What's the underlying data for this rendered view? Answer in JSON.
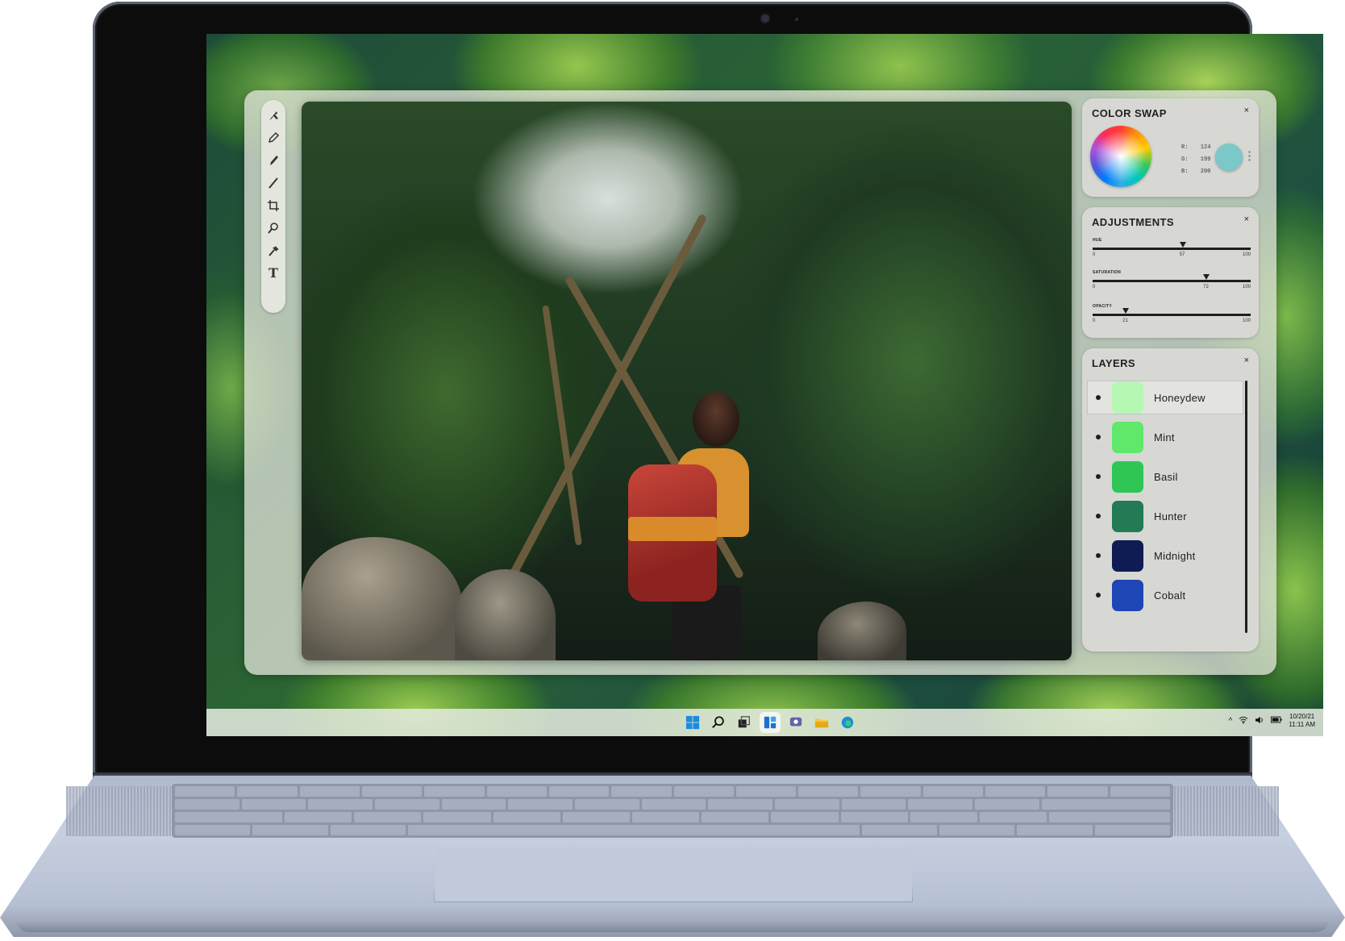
{
  "color_swap": {
    "title": "COLOR SWAP",
    "close": "×",
    "r_label": "R:",
    "r_value": "124",
    "g_label": "G:",
    "g_value": "199",
    "b_label": "B:",
    "b_value": "200",
    "preview_color": "#7cc7c8"
  },
  "adjustments": {
    "title": "ADJUSTMENTS",
    "close": "×",
    "sliders": [
      {
        "label": "HUE",
        "min": "0",
        "max": "100",
        "value": 57,
        "value_text": "57"
      },
      {
        "label": "SATURATION",
        "min": "0",
        "max": "100",
        "value": 72,
        "value_text": "72"
      },
      {
        "label": "OPACITY",
        "min": "0",
        "max": "100",
        "value": 21,
        "value_text": "21"
      }
    ]
  },
  "layers": {
    "title": "LAYERS",
    "close": "×",
    "items": [
      {
        "name": "Honeydew",
        "color": "#b4f8b4",
        "selected": true
      },
      {
        "name": "Mint",
        "color": "#5fe86a"
      },
      {
        "name": "Basil",
        "color": "#2fc656"
      },
      {
        "name": "Hunter",
        "color": "#237a54"
      },
      {
        "name": "Midnight",
        "color": "#0f1c54"
      },
      {
        "name": "Cobalt",
        "color": "#1e46b4"
      }
    ]
  },
  "toolbar": {
    "tools": [
      "select-arrow-icon",
      "pen-icon",
      "pencil-icon",
      "brush-icon",
      "crop-icon",
      "zoom-icon",
      "eyedropper-icon",
      "text-icon"
    ],
    "text_tool_glyph": "T"
  },
  "taskbar": {
    "apps": [
      "windows-start-icon",
      "search-icon",
      "task-view-icon",
      "widgets-icon",
      "chat-icon",
      "file-explorer-icon",
      "edge-icon"
    ],
    "tray_chevron": "^",
    "date": "10/20/21",
    "time": "11:11 AM"
  }
}
